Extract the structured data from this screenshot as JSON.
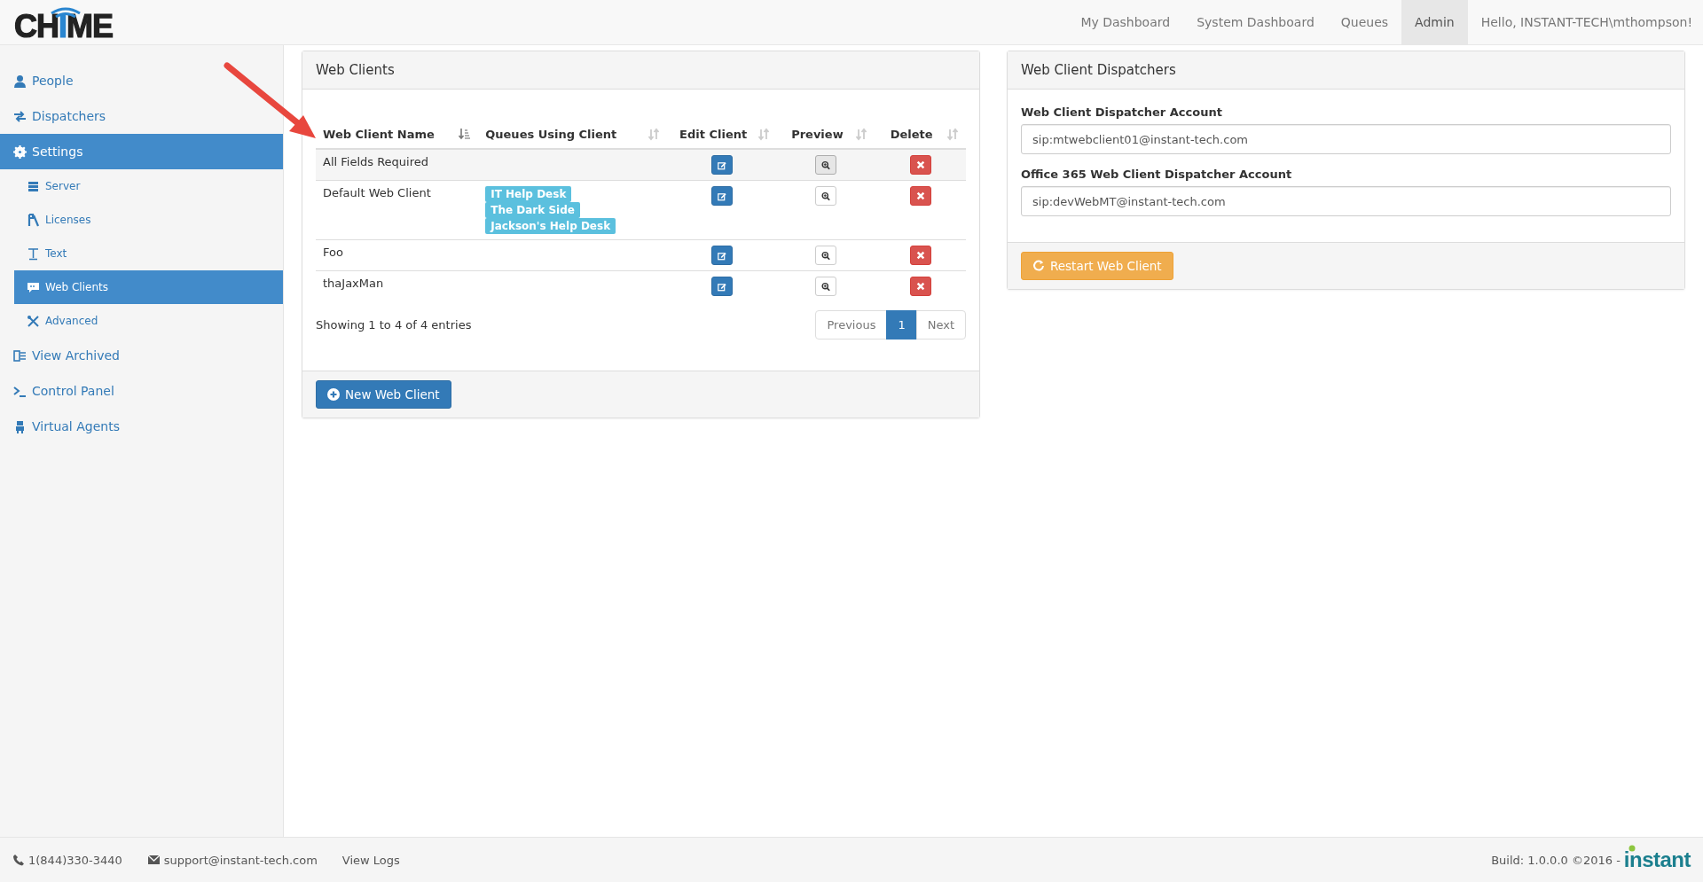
{
  "logo": {
    "text": "CHIME"
  },
  "nav": [
    {
      "label": "My Dashboard",
      "selected": false
    },
    {
      "label": "System Dashboard",
      "selected": false
    },
    {
      "label": "Queues",
      "selected": false
    },
    {
      "label": "Admin",
      "selected": true
    }
  ],
  "greeting": "Hello, INSTANT-TECH\\mthompson!",
  "sidebar": {
    "items": [
      {
        "label": "People",
        "selected": false
      },
      {
        "label": "Dispatchers",
        "selected": false
      },
      {
        "label": "Settings",
        "selected": true,
        "children": [
          {
            "label": "Server",
            "selected": false
          },
          {
            "label": "Licenses",
            "selected": false
          },
          {
            "label": "Text",
            "selected": false
          },
          {
            "label": "Web Clients",
            "selected": true
          },
          {
            "label": "Advanced",
            "selected": false
          }
        ]
      },
      {
        "label": "View Archived",
        "selected": false
      },
      {
        "label": "Control Panel",
        "selected": false
      },
      {
        "label": "Virtual Agents",
        "selected": false
      }
    ]
  },
  "web_clients": {
    "title": "Web Clients",
    "table": {
      "columns": [
        {
          "label": "Web Client Name",
          "sorted": true
        },
        {
          "label": "Queues Using Client",
          "sorted": false
        },
        {
          "label": "Edit Client",
          "sorted": false
        },
        {
          "label": "Preview",
          "sorted": false
        },
        {
          "label": "Delete",
          "sorted": false
        }
      ],
      "rows": [
        {
          "name": "All Fields Required",
          "queues": [],
          "hovered": true
        },
        {
          "name": "Default Web Client",
          "queues": [
            "IT Help Desk",
            "The Dark Side",
            "Jackson's Help Desk"
          ],
          "hovered": false
        },
        {
          "name": "Foo",
          "queues": [],
          "hovered": false
        },
        {
          "name": "thaJaxMan",
          "queues": [],
          "hovered": false
        }
      ]
    },
    "info": "Showing 1 to 4 of 4 entries",
    "pagination": [
      {
        "label": "Previous",
        "selected": false
      },
      {
        "label": "1",
        "selected": true
      },
      {
        "label": "Next",
        "selected": false
      }
    ],
    "new_button": "New Web Client"
  },
  "dispatchers": {
    "title": "Web Client Dispatchers",
    "fields": [
      {
        "label": "Web Client Dispatcher Account",
        "value": "sip:mtwebclient01@instant-tech.com"
      },
      {
        "label": "Office 365 Web Client Dispatcher Account",
        "value": "sip:devWebMT@instant-tech.com"
      }
    ],
    "restart_button": "Restart Web Client"
  },
  "footer": {
    "phone": "1(844)330-3440",
    "email": "support@instant-tech.com",
    "view_logs": "View Logs",
    "build": "Build: 1.0.0.0 ©2016 -",
    "brand": "instant"
  }
}
